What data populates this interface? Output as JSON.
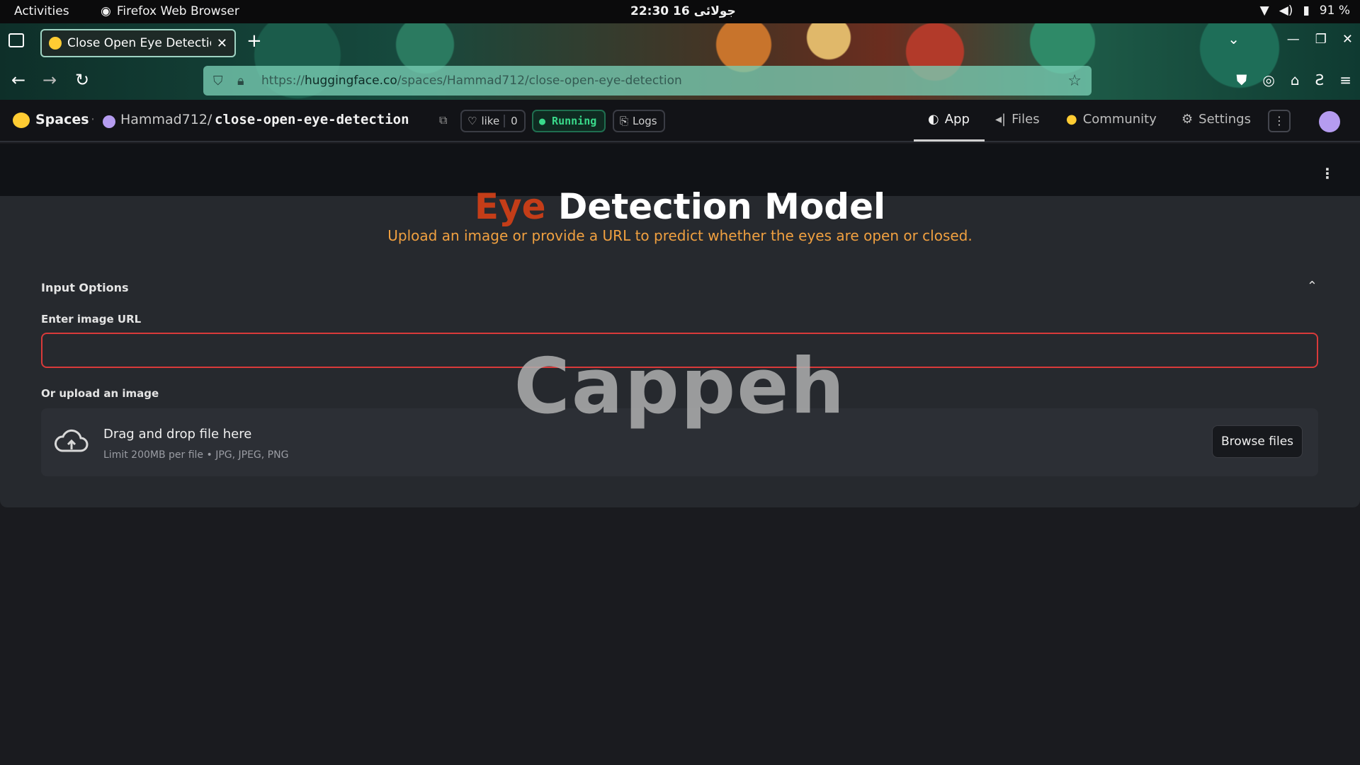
{
  "system_bar": {
    "activities": "Activities",
    "app_name": "Firefox Web Browser",
    "clock": "22:30  16 جولائی",
    "battery": "91 %"
  },
  "browser": {
    "tab_title": "Close Open Eye Detectio",
    "url_prefix": "https://",
    "url_domain": "huggingface.co",
    "url_path": "/spaces/Hammad712/close-open-eye-detection"
  },
  "hf_header": {
    "spaces": "Spaces",
    "owner": "Hammad712/",
    "repo": "close-open-eye-detection",
    "like_label": "like",
    "like_count": "0",
    "status": "● Running",
    "logs": "Logs",
    "nav": {
      "app": "App",
      "files": "Files",
      "community": "Community",
      "settings": "Settings"
    }
  },
  "app": {
    "title_part1": "Eye",
    "title_part2": " Detection Model",
    "subtitle": "Upload an image or provide a URL to predict whether the eyes are open or closed.",
    "expander_label": "Input Options",
    "url_label": "Enter image URL",
    "url_value": "",
    "upload_label": "Or upload an image",
    "drop_title": "Drag and drop file here",
    "drop_hint": "Limit 200MB per file • JPG, JPEG, PNG",
    "browse_button": "Browse files"
  },
  "watermark": "Cappeh",
  "colors": {
    "title_accent": "#c43d18",
    "subtitle": "#f0a040",
    "input_border": "#d93a3a",
    "running": "#39d98a"
  }
}
